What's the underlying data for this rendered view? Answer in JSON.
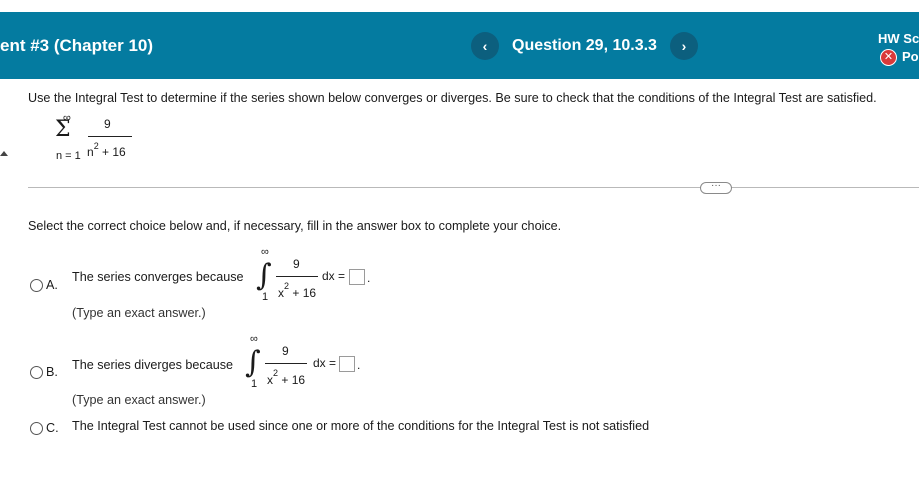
{
  "header": {
    "title": "ent #3 (Chapter 10)",
    "prev_icon": "chevron-left-icon",
    "prev_glyph": "‹",
    "question": "Question 29, 10.3.3",
    "next_icon": "chevron-right-icon",
    "next_glyph": "›",
    "score_label": "HW Sc",
    "points_label": "Po",
    "error_glyph": "✕",
    "bg_color": "#047ba0"
  },
  "instructions": "Use the Integral Test to determine if the series shown below converges or diverges. Be sure to check that the conditions of the Integral Test are satisfied.",
  "series": {
    "upper": "∞",
    "sigma": "Σ",
    "lower": "n = 1",
    "numerator": "9",
    "denominator_base": "n",
    "denominator_exp": "2",
    "denominator_rest": " + 16"
  },
  "more_button": "···",
  "select_prompt": "Select the correct choice below and, if necessary, fill in the answer box to complete your choice.",
  "options": [
    {
      "letter": "A.",
      "text": "The series converges because",
      "hint": "(Type an exact answer.)",
      "integral": {
        "upper": "∞",
        "sign": "∫",
        "lower": "1",
        "numerator": "9",
        "den_base": "x",
        "den_exp": "2",
        "den_rest": " + 16",
        "dx": "dx ="
      },
      "end": "."
    },
    {
      "letter": "B.",
      "text": "The series diverges because",
      "hint": "(Type an exact answer.)",
      "integral": {
        "upper": "∞",
        "sign": "∫",
        "lower": "1",
        "numerator": "9",
        "den_base": "x",
        "den_exp": "2",
        "den_rest": " + 16",
        "dx": "dx ="
      },
      "end": "."
    },
    {
      "letter": "C.",
      "text": "The Integral Test cannot be used since one or more of the conditions for the Integral Test is not satisfied"
    }
  ]
}
